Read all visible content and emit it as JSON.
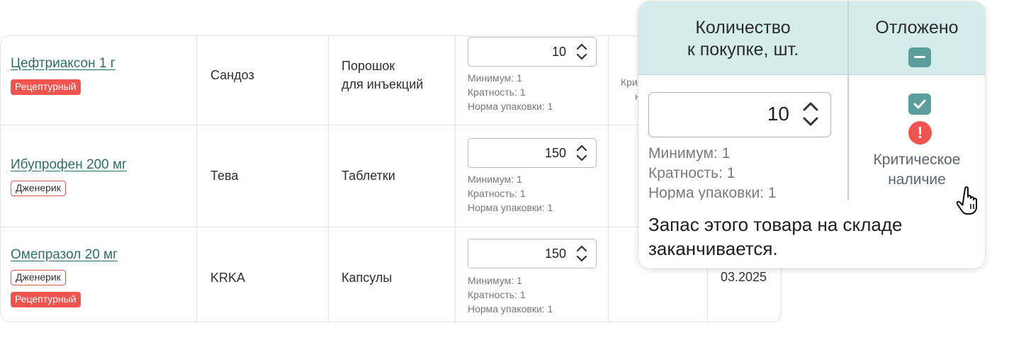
{
  "rows": [
    {
      "name": "Цефтриаксон 1 г",
      "badges": [
        "Рецептурный"
      ],
      "manufacturer": "Сандоз",
      "form": "Порошок\nдля инъекций",
      "qty": "10",
      "meta": [
        "Минимум: 1",
        "Кратность: 1",
        "Норма упаковки: 1"
      ],
      "partial_next": [
        "Кри",
        "н"
      ]
    },
    {
      "name": "Ибупрофен 200 мг",
      "badges": [
        "Дженерик"
      ],
      "manufacturer": "Тева",
      "form": "Таблетки",
      "qty": "150",
      "meta": [
        "Минимум: 1",
        "Кратность: 1",
        "Норма упаковки: 1"
      ]
    },
    {
      "name": "Омепразол 20 мг",
      "badges": [
        "Дженерик",
        "Рецептурный"
      ],
      "manufacturer": "KRKA",
      "form": "Капсулы",
      "qty": "150",
      "meta": [
        "Минимум: 1",
        "Кратность: 1",
        "Норма упаковки: 1"
      ],
      "date_partial": "03.2025"
    }
  ],
  "popover": {
    "col_qty_header": "Количество\nк покупке, шт.",
    "col_postponed_header": "Отложено",
    "qty": "10",
    "meta": [
      "Минимум: 1",
      "Кратность: 1",
      "Норма упаковки: 1"
    ],
    "status_label": "Критическое\nналичие",
    "warning_glyph": "!",
    "tooltip": "Запас этого товара на складе заканчивается."
  },
  "colors": {
    "accent": "#2f6d6a",
    "header_bg": "#d5ecec",
    "checkbox": "#5b9e9b",
    "danger": "#f0544f"
  },
  "icons": [
    "chevron-up-down-icon",
    "minus-checkbox-icon",
    "check-icon",
    "warning-icon",
    "hand-pointer-icon"
  ]
}
